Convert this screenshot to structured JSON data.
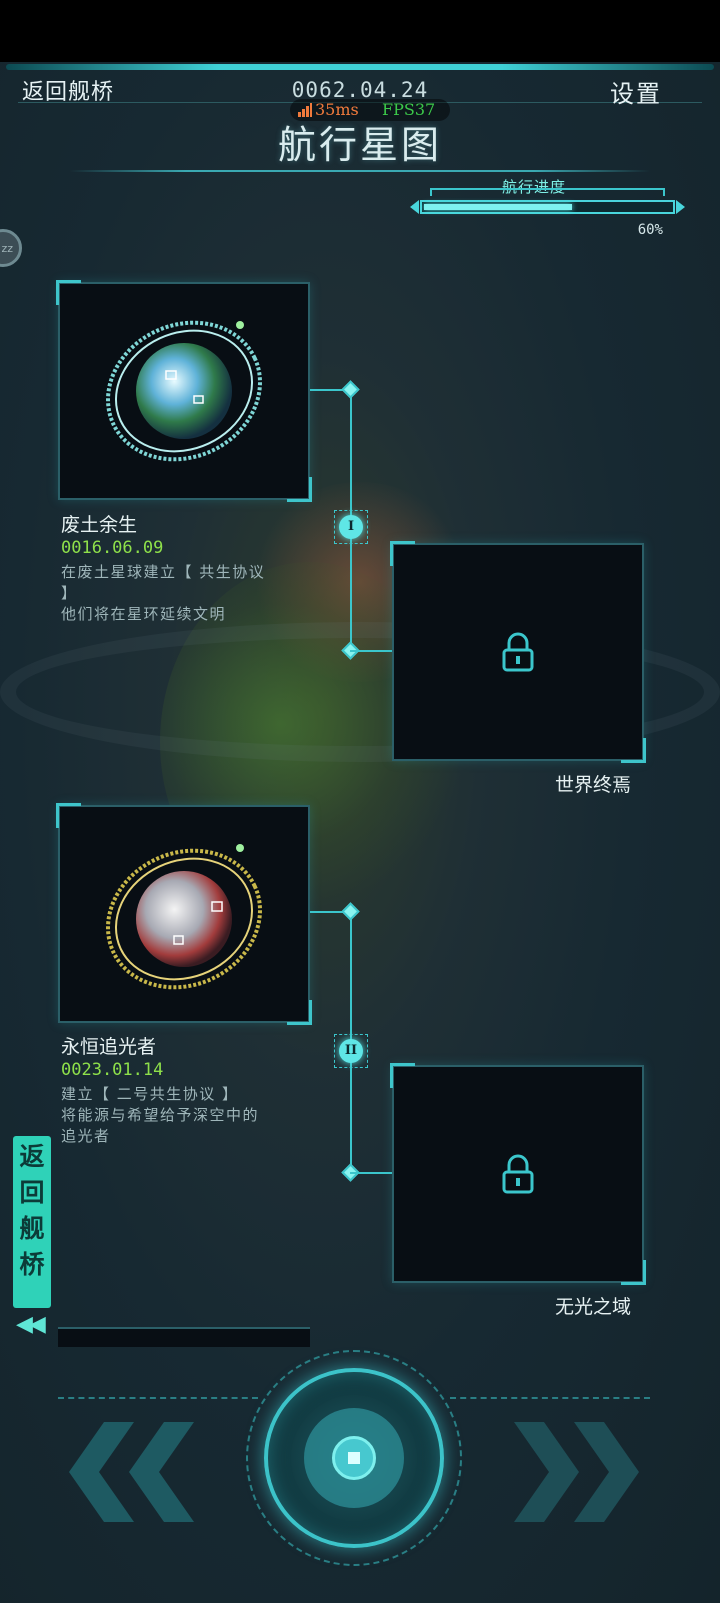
{
  "header": {
    "back_label": "返回舰桥",
    "settings_label": "设置",
    "date": "0062.04.24",
    "ping": "35ms",
    "fps": "FPS37",
    "title": "航行星图"
  },
  "progress": {
    "label": "航行进度",
    "percent_text": "60%",
    "fraction": 0.6
  },
  "sleep_button": {
    "label": "zz"
  },
  "nodes": [
    {
      "numeral": "I",
      "unlocked": {
        "name": "废土余生",
        "date": "0016.06.09",
        "desc_line1": "在废土星球建立【 共生协议",
        "desc_line2": "】",
        "desc_line3": "他们将在星环延续文明",
        "planet_icon": "ringed-earth-planet-icon"
      },
      "locked": {
        "name": "世界终焉",
        "icon": "lock-icon"
      }
    },
    {
      "numeral": "II",
      "unlocked": {
        "name": "永恒追光者",
        "date": "0023.01.14",
        "desc_line1": "建立【 二号共生协议 】",
        "desc_line2": "将能源与希望给予深空中的",
        "desc_line3": "追光者",
        "planet_icon": "ringed-moon-planet-icon"
      },
      "locked": {
        "name": "无光之域",
        "icon": "lock-icon"
      }
    }
  ],
  "side_tab": {
    "label_chars": [
      "返",
      "回",
      "舰",
      "桥"
    ],
    "arrows": "◀◀"
  },
  "colors": {
    "accent": "#3bc6cc",
    "date_green": "#8ee04a",
    "side_tab": "#2fd2b8",
    "ping": "#f07a3c",
    "fps": "#3cc94a"
  }
}
